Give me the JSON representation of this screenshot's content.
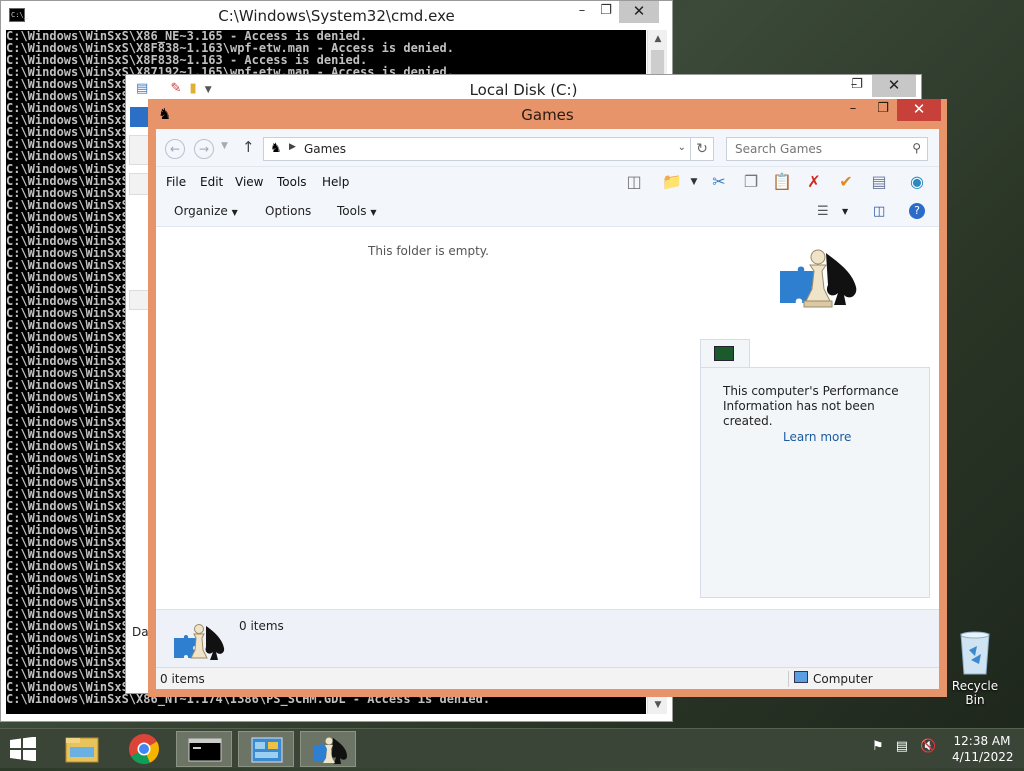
{
  "cmd": {
    "title": "C:\\Windows\\System32\\cmd.exe",
    "icon_text": "C:\\_",
    "lines": [
      "C:\\Windows\\WinSxS\\X86_NE~3.165 - Access is denied.",
      "C:\\Windows\\WinSxS\\X8F838~1.163\\wpf-etw.man - Access is denied.",
      "C:\\Windows\\WinSxS\\X8F838~1.163 - Access is denied.",
      "C:\\Windows\\WinSxS\\X87192~1.165\\wpf-etw.man - Access is denied.",
      "C:\\Windows\\WinSxS",
      "C:\\Windows\\WinSxS",
      "C:\\Windows\\WinSxS",
      "C:\\Windows\\WinSxS",
      "C:\\Windows\\WinSxS",
      "C:\\Windows\\WinSxS",
      "C:\\Windows\\WinSxS",
      "C:\\Windows\\WinSxS",
      "C:\\Windows\\WinSxS",
      "C:\\Windows\\WinSxS",
      "C:\\Windows\\WinSxS",
      "C:\\Windows\\WinSxS",
      "C:\\Windows\\WinSxS",
      "C:\\Windows\\WinSxS",
      "C:\\Windows\\WinSxS",
      "C:\\Windows\\WinSxS",
      "C:\\Windows\\WinSxS",
      "C:\\Windows\\WinSxS",
      "C:\\Windows\\WinSxS",
      "C:\\Windows\\WinSxS",
      "C:\\Windows\\WinSxS",
      "C:\\Windows\\WinSxS",
      "C:\\Windows\\WinSxS",
      "C:\\Windows\\WinSxS",
      "C:\\Windows\\WinSxS",
      "C:\\Windows\\WinSxS",
      "C:\\Windows\\WinSxS",
      "C:\\Windows\\WinSxS",
      "C:\\Windows\\WinSxS",
      "C:\\Windows\\WinSxS",
      "C:\\Windows\\WinSxS",
      "C:\\Windows\\WinSxS",
      "C:\\Windows\\WinSxS",
      "C:\\Windows\\WinSxS",
      "C:\\Windows\\WinSxS",
      "C:\\Windows\\WinSxS",
      "C:\\Windows\\WinSxS",
      "C:\\Windows\\WinSxS",
      "C:\\Windows\\WinSxS",
      "C:\\Windows\\WinSxS",
      "C:\\Windows\\WinSxS",
      "C:\\Windows\\WinSxS",
      "C:\\Windows\\WinSxS",
      "C:\\Windows\\WinSxS",
      "C:\\Windows\\WinSxS",
      "C:\\Windows\\WinSxS",
      "C:\\Windows\\WinSxS",
      "C:\\Windows\\WinSxS",
      "C:\\Windows\\WinSxS",
      "C:\\Windows\\WinSxS",
      "C:\\Windows\\WinSxS\\X86_NE~",
      "C:\\Windows\\WinSxS\\X86_NT~1.174\\I386\\PS_SCHM.GDL - Access is denied."
    ]
  },
  "localdisk": {
    "title": "Local Disk (C:)",
    "fragments": [
      "Dat"
    ]
  },
  "games": {
    "title": "Games",
    "address": {
      "path": "Games"
    },
    "search": {
      "placeholder": "Search Games"
    },
    "menu": [
      "File",
      "Edit",
      "View",
      "Tools",
      "Help"
    ],
    "commands": {
      "organize": "Organize",
      "options": "Options",
      "tools": "Tools"
    },
    "empty_message": "This folder is empty.",
    "perf": {
      "message": "This computer's Performance Information has not been created.",
      "link": "Learn more"
    },
    "details": {
      "count": "0 items"
    },
    "status": {
      "items": "0 items",
      "location": "Computer"
    },
    "colors": {
      "frame": "#e8946a",
      "close": "#c7403a",
      "link": "#1c5a9e"
    }
  },
  "desktop": {
    "recycle_bin": "Recycle Bin"
  },
  "taskbar": {
    "time": "12:38 AM",
    "date": "4/11/2022",
    "items": [
      "windows-start",
      "file-explorer",
      "chrome",
      "command-prompt",
      "control-panel",
      "games"
    ]
  }
}
